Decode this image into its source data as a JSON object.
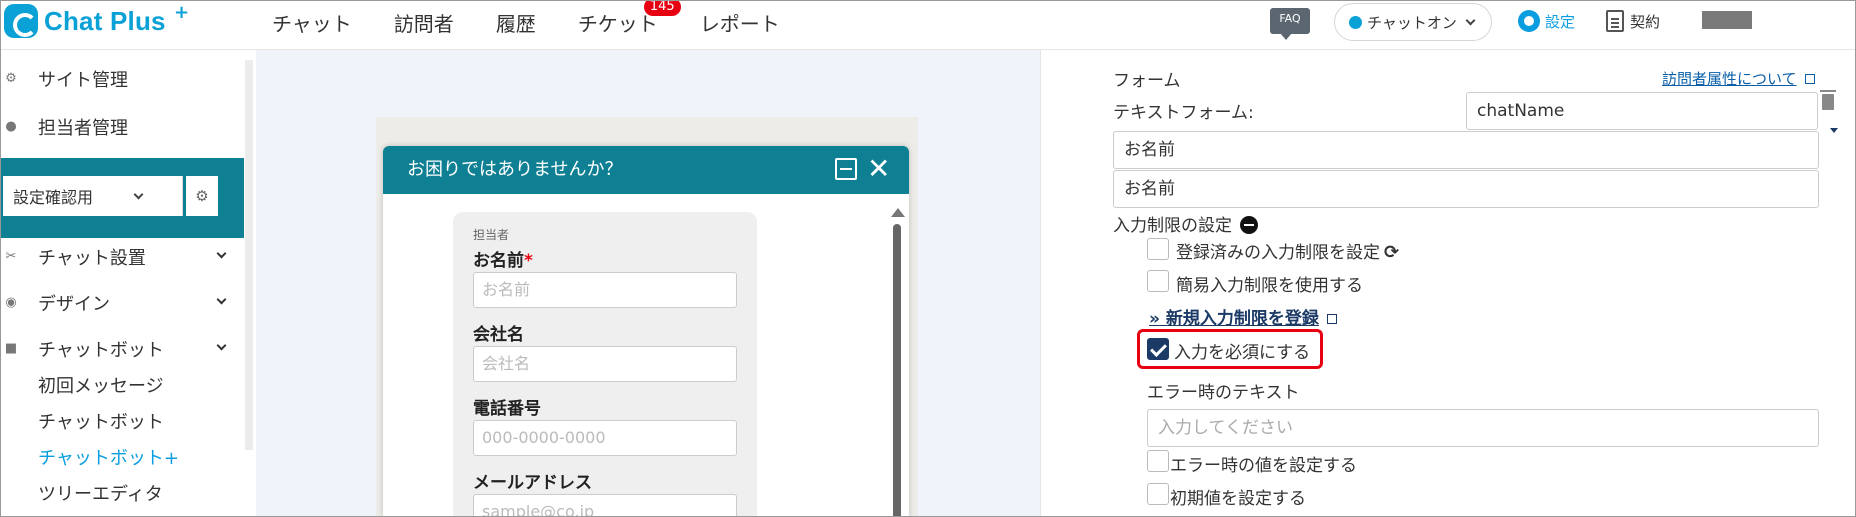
{
  "header": {
    "logo_text": "Chat Plus",
    "logo_plus": "+",
    "nav": [
      "チャット",
      "訪問者",
      "履歴",
      "チケット",
      "レポート"
    ],
    "ticket_badge": "145",
    "faq_label": "FAQ",
    "chat_status": "チャットオン",
    "settings_label": "設定",
    "contract_label": "契約"
  },
  "sidebar": {
    "site_admin": "サイト管理",
    "staff_admin": "担当者管理",
    "site_select_value": "設定確認用",
    "chat_settings": "チャット設置",
    "design": "デザイン",
    "chatbot": "チャットボット",
    "sub_items": [
      "初回メッセージ",
      "チャットボット",
      "チャットボット+",
      "ツリーエディタ"
    ]
  },
  "preview": {
    "header_title": "お困りではありませんか？",
    "staff_label": "担当者",
    "fields": [
      {
        "label": "お名前",
        "required": "*",
        "placeholder": "お名前"
      },
      {
        "label": "会社名",
        "required": "",
        "placeholder": "会社名"
      },
      {
        "label": "電話番号",
        "required": "",
        "placeholder": "000-0000-0000"
      },
      {
        "label": "メールアドレス",
        "required": "",
        "placeholder": "sample@co.jp"
      }
    ]
  },
  "form_panel": {
    "section_title": "フォーム",
    "visitor_attr_link": "訪問者属性について",
    "text_form_label": "テキストフォーム:",
    "text_form_value": "chatName",
    "name_field_1": "お名前",
    "name_field_2": "お名前",
    "input_restriction_label": "入力制限の設定",
    "use_registered_restriction": "登録済みの入力制限を設定",
    "use_simple_restriction": "簡易入力制限を使用する",
    "new_restriction_link": "» 新規入力制限を登録",
    "required_checkbox": "入力を必須にする",
    "required_checked": true,
    "error_text_label": "エラー時のテキスト",
    "error_text_placeholder": "入力してください",
    "set_error_value": "エラー時の値を設定する",
    "set_initial_value": "初期値を設定する"
  },
  "colors": {
    "brand": "#0aa1d6",
    "teal": "#0f7f93",
    "highlight": "#e60012",
    "navy": "#1b3a66"
  }
}
